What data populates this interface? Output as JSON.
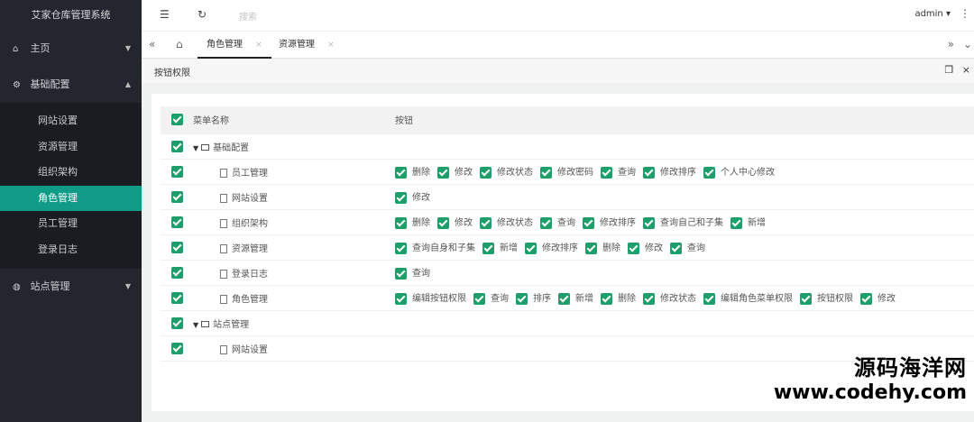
{
  "app": {
    "title": "艾家仓库管理系统"
  },
  "sidebar": {
    "items": [
      {
        "label": "主页",
        "icon": "home-icon",
        "expanded": false
      },
      {
        "label": "基础配置",
        "icon": "gear-icon",
        "expanded": true,
        "children": [
          "网站设置",
          "资源管理",
          "组织架构",
          "角色管理",
          "员工管理",
          "登录日志"
        ],
        "active_child": "角色管理"
      },
      {
        "label": "站点管理",
        "icon": "globe-icon",
        "expanded": false
      }
    ]
  },
  "header": {
    "search_placeholder": "搜索",
    "user": "admin"
  },
  "tabs": [
    {
      "label": "角色管理",
      "active": true
    },
    {
      "label": "资源管理",
      "active": false
    }
  ],
  "page": {
    "title": "按钮权限"
  },
  "table": {
    "headers": {
      "menu": "菜单名称",
      "buttons": "按钮"
    },
    "rows": [
      {
        "name": "基础配置",
        "type": "folder",
        "perms": []
      },
      {
        "name": "员工管理",
        "type": "file",
        "perms": [
          "删除",
          "修改",
          "修改状态",
          "修改密码",
          "查询",
          "修改排序",
          "个人中心修改"
        ]
      },
      {
        "name": "网站设置",
        "type": "file",
        "perms": [
          "修改"
        ]
      },
      {
        "name": "组织架构",
        "type": "file",
        "perms": [
          "删除",
          "修改",
          "修改状态",
          "查询",
          "修改排序",
          "查询自己和子集",
          "新增"
        ]
      },
      {
        "name": "资源管理",
        "type": "file",
        "perms": [
          "查询自身和子集",
          "新增",
          "修改排序",
          "删除",
          "修改",
          "查询"
        ]
      },
      {
        "name": "登录日志",
        "type": "file",
        "perms": [
          "查询"
        ]
      },
      {
        "name": "角色管理",
        "type": "file",
        "perms": [
          "编辑按钮权限",
          "查询",
          "排序",
          "新增",
          "删除",
          "修改状态",
          "编辑角色菜单权限",
          "按钮权限",
          "修改"
        ]
      },
      {
        "name": "站点管理",
        "type": "folder",
        "perms": []
      },
      {
        "name": "网站设置",
        "type": "file",
        "perms": []
      }
    ]
  },
  "watermark": {
    "line1": "源码海洋网",
    "line2": "www.codehy.com"
  },
  "colors": {
    "sidebar_bg": "#23262e",
    "active": "#0f9b86",
    "checkbox": "#1e9e6a"
  }
}
